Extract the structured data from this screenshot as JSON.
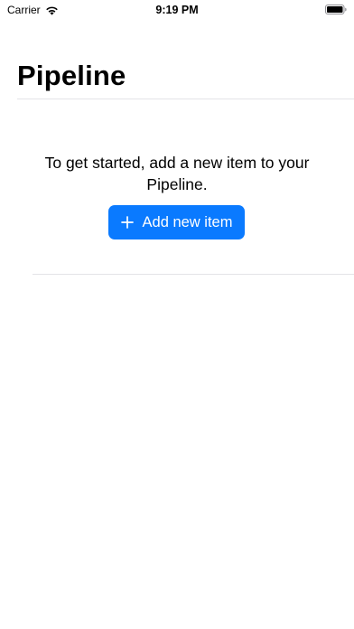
{
  "status_bar": {
    "carrier": "Carrier",
    "time": "9:19 PM"
  },
  "header": {
    "title": "Pipeline"
  },
  "empty_state": {
    "message": "To get started, add a new item to your Pipeline.",
    "button_label": "Add new item",
    "button_icon": "plus-icon"
  },
  "colors": {
    "accent": "#0a7aff",
    "divider": "#e4e4e7",
    "background": "#ffffff"
  }
}
